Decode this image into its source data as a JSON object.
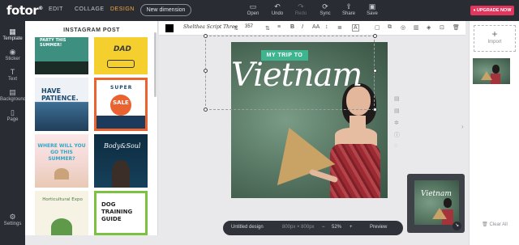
{
  "app": {
    "logo": "fotor",
    "nav": [
      {
        "label": "EDIT",
        "active": false
      },
      {
        "label": "COLLAGE",
        "active": false
      },
      {
        "label": "DESIGN",
        "active": true
      }
    ],
    "new_dimension": "New dimension",
    "tools": [
      {
        "label": "Open",
        "icon": "folder-icon",
        "glyph": "▭",
        "disabled": false
      },
      {
        "label": "Undo",
        "icon": "undo-icon",
        "glyph": "↶",
        "disabled": false
      },
      {
        "label": "Redo",
        "icon": "redo-icon",
        "glyph": "↷",
        "disabled": true
      },
      {
        "label": "Sync",
        "icon": "sync-icon",
        "glyph": "⟳",
        "disabled": false
      },
      {
        "label": "Share",
        "icon": "share-icon",
        "glyph": "⇪",
        "disabled": false
      },
      {
        "label": "Save",
        "icon": "save-icon",
        "glyph": "▣",
        "disabled": false
      }
    ],
    "upgrade": "UPGRADE NOW",
    "accent": "#f2a83b",
    "upgrade_color": "#e0355c"
  },
  "sidebar": {
    "items": [
      {
        "label": "Template",
        "icon": "template-icon",
        "glyph": "▦",
        "active": true
      },
      {
        "label": "Sticker",
        "icon": "sticker-icon",
        "glyph": "◉",
        "active": false
      },
      {
        "label": "Text",
        "icon": "text-icon",
        "glyph": "T",
        "active": false
      },
      {
        "label": "Background",
        "icon": "background-icon",
        "glyph": "▤",
        "active": false
      },
      {
        "label": "Page",
        "icon": "page-icon",
        "glyph": "▯",
        "active": false
      },
      {
        "label": "Settings",
        "icon": "gear-icon",
        "glyph": "⚙",
        "active": false
      }
    ]
  },
  "panel": {
    "title": "INSTAGRAM POST",
    "templates": {
      "summer_party": "PARTY THIS SUMMER!",
      "dad": "DAD",
      "patience": "HAVE PATIENCE.",
      "super": "SUPER",
      "sale": "SALE",
      "summer_q": "WHERE WILL YOU GO THIS SUMMER?",
      "body_soul": "Body&Soul",
      "horticultural": "Horticultural Expo",
      "dog": "DOG TRAINING GUIDE"
    }
  },
  "texttool": {
    "font": "Shelthea Script Three",
    "size": "357",
    "swatch_color": "#000000"
  },
  "canvas": {
    "badge": "MY TRIP TO",
    "headline": "Vietnam",
    "badge_color": "#3fb58f"
  },
  "bottom": {
    "title": "Untitled design",
    "dimensions": "800px × 800px",
    "zoom_minus": "−",
    "zoom": "52%",
    "zoom_plus": "+",
    "preview": "Preview"
  },
  "pages": {
    "import": "Import",
    "clear_all": "Clear All"
  }
}
